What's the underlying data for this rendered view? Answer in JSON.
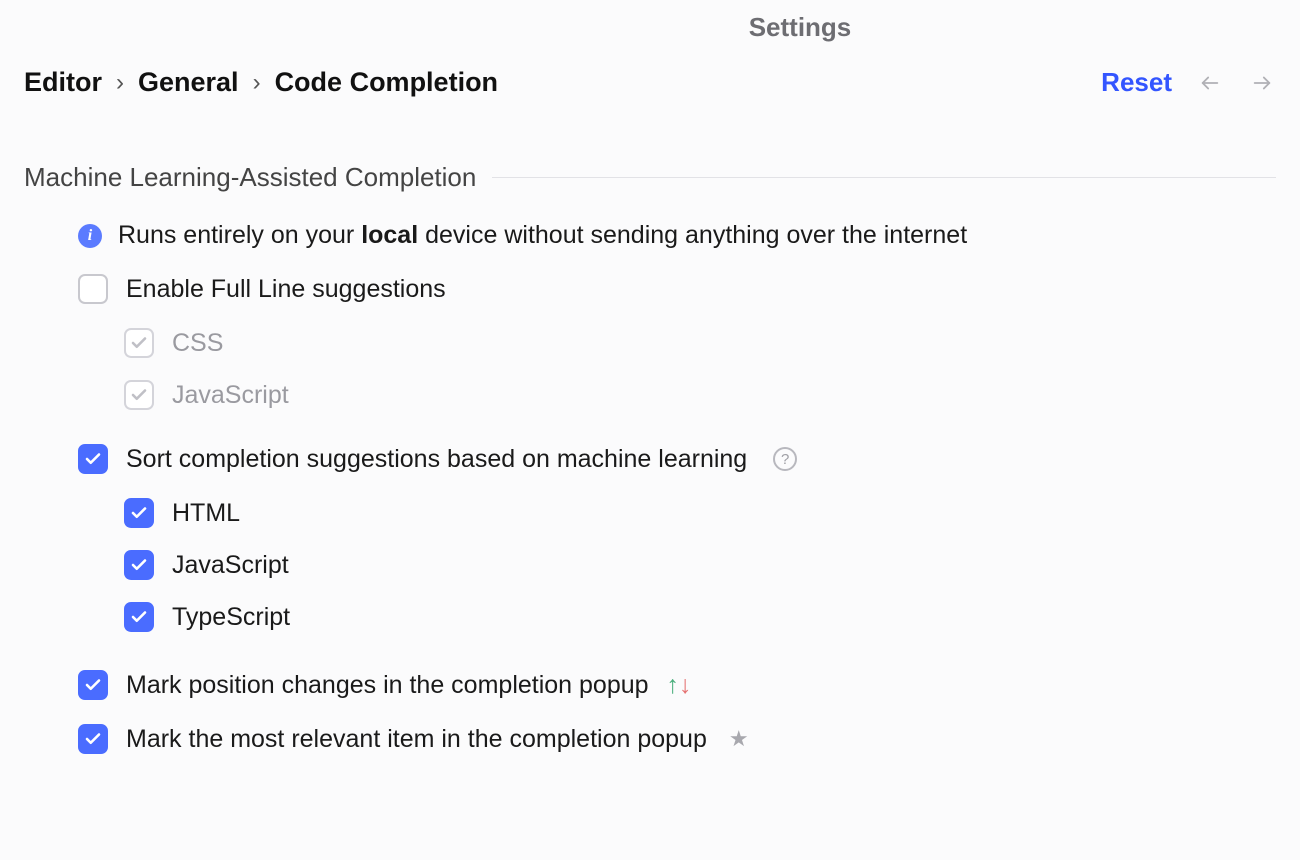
{
  "page_title": "Settings",
  "breadcrumb": {
    "items": [
      "Editor",
      "General",
      "Code Completion"
    ],
    "separator": "›"
  },
  "reset_label": "Reset",
  "section": {
    "title": "Machine Learning-Assisted Completion",
    "info_prefix": "Runs entirely on your ",
    "info_bold": "local",
    "info_suffix": " device without sending anything over the internet",
    "options": {
      "enable_full_line": {
        "label": "Enable Full Line suggestions",
        "checked": false
      },
      "full_line_children": [
        {
          "label": "CSS",
          "checked": true,
          "disabled": true
        },
        {
          "label": "JavaScript",
          "checked": true,
          "disabled": true
        }
      ],
      "sort_ml": {
        "label": "Sort completion suggestions based on machine learning",
        "checked": true
      },
      "sort_ml_children": [
        {
          "label": "HTML",
          "checked": true
        },
        {
          "label": "JavaScript",
          "checked": true
        },
        {
          "label": "TypeScript",
          "checked": true
        }
      ],
      "mark_position": {
        "label": "Mark position changes in the completion popup",
        "checked": true
      },
      "mark_relevant": {
        "label": "Mark the most relevant item in the completion popup",
        "checked": true
      }
    }
  }
}
